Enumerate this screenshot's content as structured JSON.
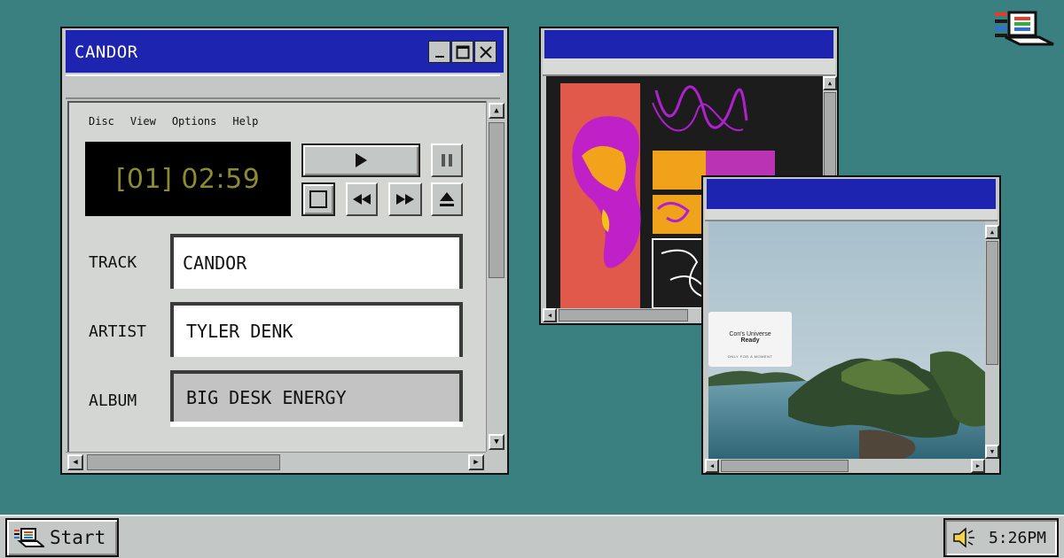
{
  "player": {
    "title": "CANDOR",
    "menu": [
      "Disc",
      "View",
      "Options",
      "Help"
    ],
    "display": "[01] 02:59",
    "fields": [
      {
        "label": "TRACK",
        "value": "CANDOR"
      },
      {
        "label": "ARTIST",
        "value": "TYLER DENK"
      },
      {
        "label": "ALBUM",
        "value": "BIG DESK ENERGY"
      }
    ]
  },
  "photo_window": {
    "card_title": "Con's Universe",
    "card_subtitle": "Ready",
    "card_note": "ONLY FOR A MOMENT"
  },
  "taskbar": {
    "start_label": "Start",
    "clock": "5:26PM"
  },
  "icons": {
    "desktop": "computer-logo-icon",
    "start": "computer-icon",
    "tray": "speaker-icon"
  },
  "colors": {
    "desktop": "#3b8080",
    "titlebar": "#1d24b0",
    "chrome": "#c3c7c5",
    "lcd_text": "#8b8b34"
  }
}
